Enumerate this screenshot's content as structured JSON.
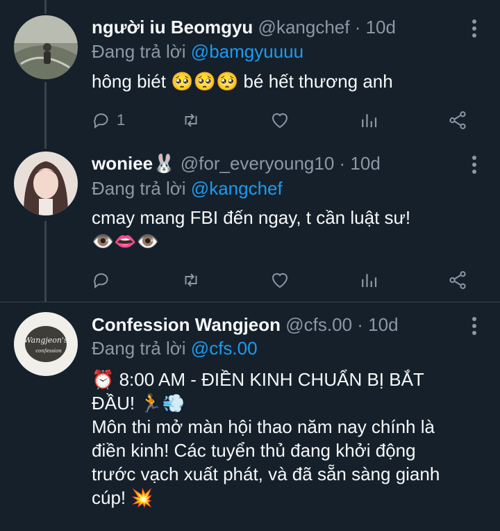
{
  "tweets": [
    {
      "name": "người iu Beomgyu",
      "handle": "@kangchef",
      "time": "· 10d",
      "replying_label": "Đang trả lời",
      "replying_to": "@bamgyuuuu",
      "text_lines": [
        "hông biét 🥺🥺🥺 bé hết thương anh"
      ],
      "reply_count": "1"
    },
    {
      "name": "woniee🐰",
      "handle": "@for_everyoung10",
      "time": "· 10d",
      "replying_label": "Đang trả lời",
      "replying_to": "@kangchef",
      "text_lines": [
        "cmay mang FBI đến ngay, t cần luật sư!",
        "👁️👄👁️"
      ],
      "reply_count": ""
    },
    {
      "name": "Confession Wangjeon",
      "handle": "@cfs.00",
      "time": "· 10d",
      "replying_label": "Đang trả lời",
      "replying_to": "@cfs.00",
      "text_lines": [
        "⏰ 8:00 AM - ĐIỀN KINH CHUẨN BỊ BẮT",
        "ĐẦU! 🏃💨",
        "Môn thi mở màn hội thao năm nay chính là",
        "điền kinh! Các tuyển thủ đang khởi động",
        "trước vạch xuất phát, và đã sẵn sàng gianh",
        "cúp! 💥"
      ],
      "avatar_text_top": "Wangjeon's",
      "avatar_text_bottom": "confession"
    }
  ]
}
